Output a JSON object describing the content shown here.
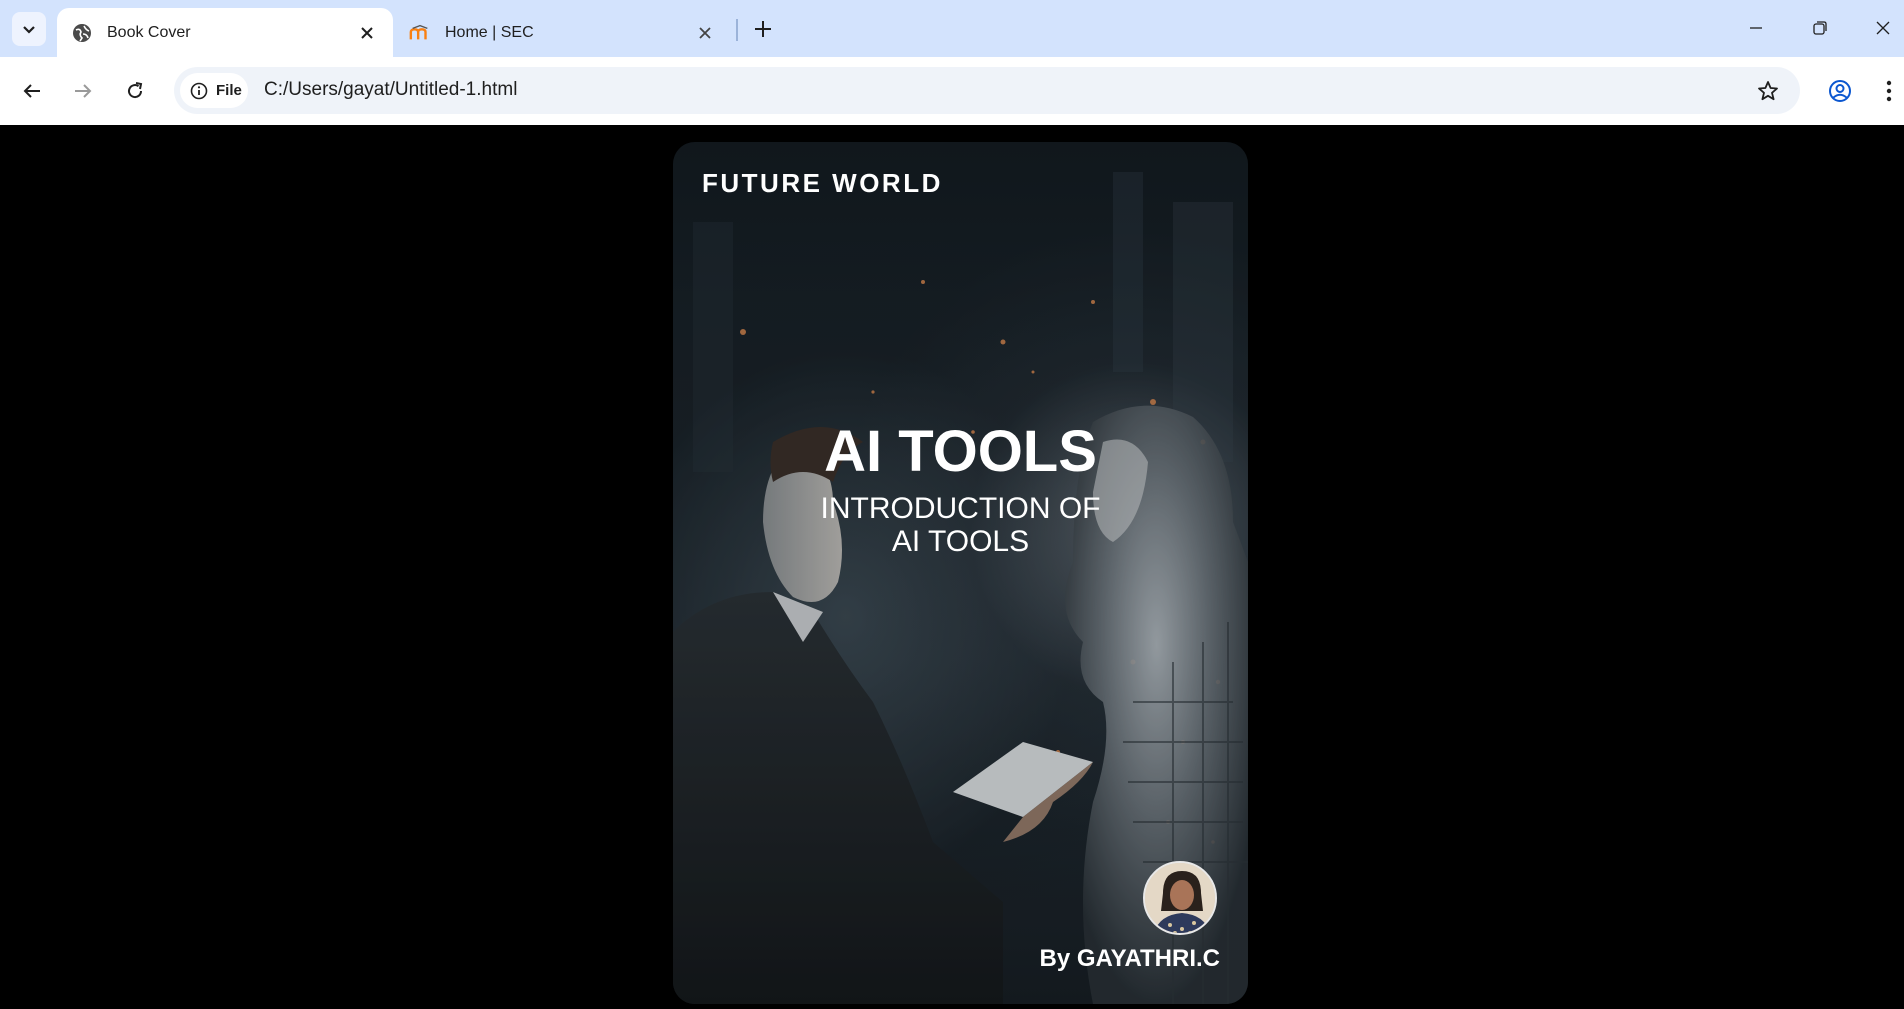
{
  "browser": {
    "tabs": [
      {
        "title": "Book Cover",
        "favicon": "globe-icon",
        "active": true
      },
      {
        "title": "Home | SEC",
        "favicon": "moodle-icon",
        "active": false
      }
    ],
    "address": {
      "chip_label": "File",
      "url": "C:/Users/gayat/Untitled-1.html"
    },
    "colors": {
      "tabstrip": "#d3e3fd",
      "omnibox": "#eff3f9",
      "accent": "#0b57d0"
    }
  },
  "cover": {
    "series": "FUTURE WORLD",
    "title": "AI TOOLS",
    "subtitle_line1": "INTRODUCTION OF",
    "subtitle_line2": "AI TOOLS",
    "author": "By GAYATHRI.C",
    "colors": {
      "page_background": "#000000",
      "text": "#ffffff"
    }
  }
}
